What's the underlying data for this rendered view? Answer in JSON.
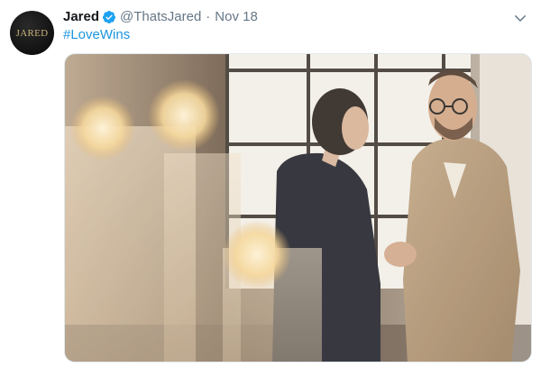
{
  "tweet": {
    "author_name": "Jared",
    "handle": "@ThatsJared",
    "separator": "·",
    "date": "Nov 18",
    "hashtag": "#LoveWins",
    "avatar_logo": "JARED",
    "icons": {
      "verified": "verified-badge-icon",
      "more": "chevron-down-icon"
    },
    "colors": {
      "name": "#14171a",
      "muted": "#657786",
      "link": "#1b95e0",
      "verified": "#1da1f2"
    }
  }
}
